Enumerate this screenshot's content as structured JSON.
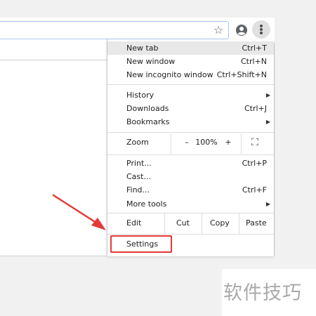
{
  "menu": {
    "new_tab": {
      "label": "New tab",
      "shortcut": "Ctrl+T"
    },
    "new_window": {
      "label": "New window",
      "shortcut": "Ctrl+N"
    },
    "new_incognito": {
      "label": "New incognito window",
      "shortcut": "Ctrl+Shift+N"
    },
    "history": {
      "label": "History"
    },
    "downloads": {
      "label": "Downloads",
      "shortcut": "Ctrl+J"
    },
    "bookmarks": {
      "label": "Bookmarks"
    },
    "zoom": {
      "label": "Zoom",
      "minus": "–",
      "level": "100%",
      "plus": "+",
      "fullscreen_icon": "fullscreen-icon"
    },
    "print": {
      "label": "Print...",
      "shortcut": "Ctrl+P"
    },
    "cast": {
      "label": "Cast..."
    },
    "find": {
      "label": "Find...",
      "shortcut": "Ctrl+F"
    },
    "more_tools": {
      "label": "More tools"
    },
    "edit": {
      "label": "Edit",
      "cut": "Cut",
      "copy": "Copy",
      "paste": "Paste"
    },
    "settings": {
      "label": "Settings"
    }
  },
  "toolbar": {
    "icons": [
      "star-icon",
      "profile-icon",
      "kebab-menu-icon"
    ]
  },
  "annotation": {
    "highlight_color": "#e53935"
  },
  "watermark": {
    "text": "软件技巧"
  }
}
